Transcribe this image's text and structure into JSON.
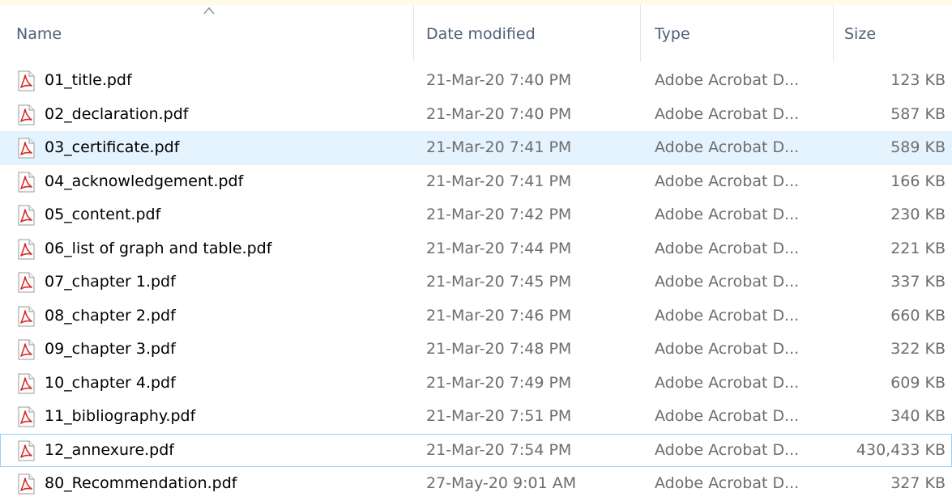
{
  "columns": {
    "name": "Name",
    "date": "Date modified",
    "type": "Type",
    "size": "Size"
  },
  "sort": {
    "column": "name",
    "icon": "chevron-up-icon"
  },
  "accent_colors": {
    "hover_row": "#e5f3ff",
    "focus_border": "#99d1ff",
    "pdf_icon": "#d62a2a"
  },
  "files": [
    {
      "name": "01_title.pdf",
      "date": "21-Mar-20 7:40 PM",
      "type": "Adobe Acrobat D...",
      "size": "123 KB",
      "icon": "pdf-file-icon"
    },
    {
      "name": "02_declaration.pdf",
      "date": "21-Mar-20 7:40 PM",
      "type": "Adobe Acrobat D...",
      "size": "587 KB",
      "icon": "pdf-file-icon"
    },
    {
      "name": "03_certificate.pdf",
      "date": "21-Mar-20 7:41 PM",
      "type": "Adobe Acrobat D...",
      "size": "589 KB",
      "icon": "pdf-file-icon"
    },
    {
      "name": "04_acknowledgement.pdf",
      "date": "21-Mar-20 7:41 PM",
      "type": "Adobe Acrobat D...",
      "size": "166 KB",
      "icon": "pdf-file-icon"
    },
    {
      "name": "05_content.pdf",
      "date": "21-Mar-20 7:42 PM",
      "type": "Adobe Acrobat D...",
      "size": "230 KB",
      "icon": "pdf-file-icon"
    },
    {
      "name": "06_list of graph and table.pdf",
      "date": "21-Mar-20 7:44 PM",
      "type": "Adobe Acrobat D...",
      "size": "221 KB",
      "icon": "pdf-file-icon"
    },
    {
      "name": "07_chapter 1.pdf",
      "date": "21-Mar-20 7:45 PM",
      "type": "Adobe Acrobat D...",
      "size": "337 KB",
      "icon": "pdf-file-icon"
    },
    {
      "name": "08_chapter 2.pdf",
      "date": "21-Mar-20 7:46 PM",
      "type": "Adobe Acrobat D...",
      "size": "660 KB",
      "icon": "pdf-file-icon"
    },
    {
      "name": "09_chapter 3.pdf",
      "date": "21-Mar-20 7:48 PM",
      "type": "Adobe Acrobat D...",
      "size": "322 KB",
      "icon": "pdf-file-icon"
    },
    {
      "name": "10_chapter 4.pdf",
      "date": "21-Mar-20 7:49 PM",
      "type": "Adobe Acrobat D...",
      "size": "609 KB",
      "icon": "pdf-file-icon"
    },
    {
      "name": "11_bibliography.pdf",
      "date": "21-Mar-20 7:51 PM",
      "type": "Adobe Acrobat D...",
      "size": "340 KB",
      "icon": "pdf-file-icon"
    },
    {
      "name": "12_annexure.pdf",
      "date": "21-Mar-20 7:54 PM",
      "type": "Adobe Acrobat D...",
      "size": "430,433 KB",
      "icon": "pdf-file-icon"
    },
    {
      "name": "80_Recommendation.pdf",
      "date": "27-May-20 9:01 AM",
      "type": "Adobe Acrobat D...",
      "size": "327 KB",
      "icon": "pdf-file-icon"
    }
  ]
}
